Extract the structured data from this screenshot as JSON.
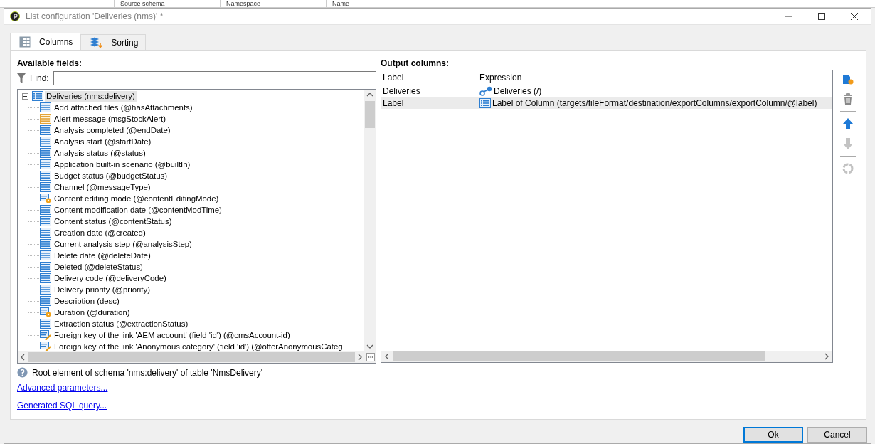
{
  "background_window": {
    "columns": [
      "Source schema",
      "Namespace",
      "Name"
    ]
  },
  "window": {
    "title": "List configuration 'Deliveries (nms)' *"
  },
  "tabs": [
    {
      "label": "Columns",
      "selected": true
    },
    {
      "label": "Sorting",
      "selected": false
    }
  ],
  "available_fields": {
    "title": "Available fields:",
    "find_label": "Find:",
    "tree": [
      {
        "label": "Deliveries (nms:delivery)",
        "kind": "field",
        "expanded": true,
        "selected": true,
        "children": [
          {
            "label": "Add attached files (@hasAttachments)",
            "kind": "field",
            "selected": false
          },
          {
            "label": "Alert message (msgStockAlert)",
            "kind": "element",
            "selected": false
          },
          {
            "label": "Analysis completed (@endDate)",
            "kind": "field",
            "selected": false
          },
          {
            "label": "Analysis start (@startDate)",
            "kind": "field",
            "selected": false
          },
          {
            "label": "Analysis status (@status)",
            "kind": "field",
            "selected": false
          },
          {
            "label": "Application built-in scenario (@builtIn)",
            "kind": "field",
            "selected": false
          },
          {
            "label": "Budget status (@budgetStatus)",
            "kind": "field",
            "selected": false
          },
          {
            "label": "Channel (@messageType)",
            "kind": "field",
            "selected": false
          },
          {
            "label": "Content editing mode (@contentEditingMode)",
            "kind": "computed",
            "selected": false
          },
          {
            "label": "Content modification date (@contentModTime)",
            "kind": "field",
            "selected": false
          },
          {
            "label": "Content status (@contentStatus)",
            "kind": "field",
            "selected": false
          },
          {
            "label": "Creation date (@created)",
            "kind": "field",
            "selected": false
          },
          {
            "label": "Current analysis step (@analysisStep)",
            "kind": "field",
            "selected": false
          },
          {
            "label": "Delete date (@deleteDate)",
            "kind": "field",
            "selected": false
          },
          {
            "label": "Deleted (@deleteStatus)",
            "kind": "field",
            "selected": false
          },
          {
            "label": "Delivery code (@deliveryCode)",
            "kind": "field",
            "selected": false
          },
          {
            "label": "Delivery priority (@priority)",
            "kind": "field",
            "selected": false
          },
          {
            "label": "Description (desc)",
            "kind": "field",
            "selected": false
          },
          {
            "label": "Duration (@duration)",
            "kind": "computed",
            "selected": false
          },
          {
            "label": "Extraction status (@extractionStatus)",
            "kind": "field",
            "selected": false
          },
          {
            "label": "Foreign key of the link 'AEM account' (field 'id') (@cmsAccount-id)",
            "kind": "foreign-key",
            "selected": false
          },
          {
            "label": "Foreign key of the link 'Anonymous category' (field 'id') (@offerAnonymousCateg",
            "kind": "foreign-key",
            "selected": false
          }
        ]
      }
    ],
    "description": "Root element of schema 'nms:delivery' of table 'NmsDelivery'",
    "links": [
      "Advanced parameters...",
      "Generated SQL query..."
    ]
  },
  "output_columns": {
    "title": "Output columns:",
    "columns": [
      "Label",
      "Expression"
    ],
    "rows": [
      {
        "label": "Deliveries",
        "expression": "Deliveries (/)",
        "kind": "link",
        "selected": false
      },
      {
        "label": "Label",
        "expression": "Label of Column (targets/fileFormat/destination/exportColumns/exportColumn/@label)",
        "kind": "field",
        "selected": true
      }
    ]
  },
  "toolbar": [
    {
      "kind": "add",
      "disabled": false
    },
    {
      "kind": "delete",
      "disabled": false
    },
    {
      "kind": "separator"
    },
    {
      "kind": "up",
      "disabled": false
    },
    {
      "kind": "down",
      "disabled": true
    },
    {
      "kind": "separator"
    },
    {
      "kind": "reset",
      "disabled": true
    }
  ],
  "buttons": [
    {
      "label": "Ok",
      "default": true
    },
    {
      "label": "Cancel",
      "default": false
    }
  ]
}
